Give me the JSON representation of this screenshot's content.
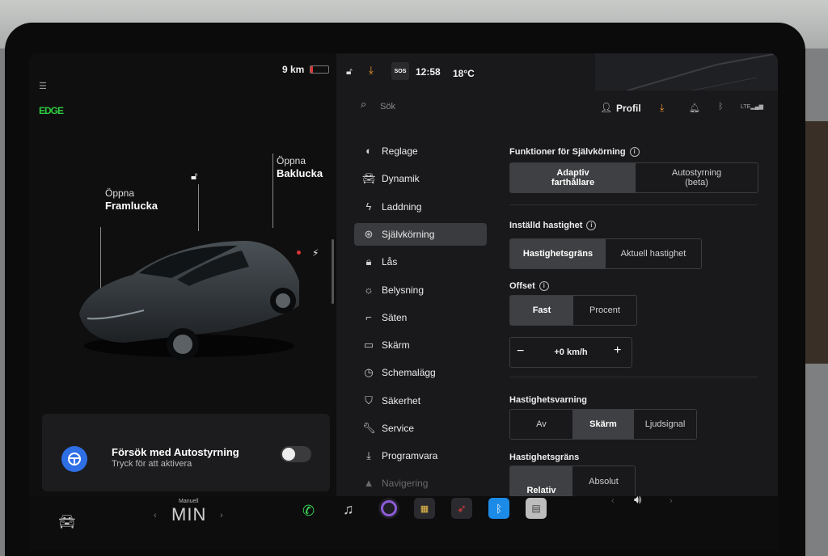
{
  "status": {
    "range": "9 km",
    "time": "12:58",
    "temperature": "18°C",
    "sos": "SOS"
  },
  "car": {
    "frunk_line1": "Öppna",
    "frunk_line2": "Framlucka",
    "trunk_line1": "Öppna",
    "trunk_line2": "Baklucka",
    "edge_badge": "EDGE"
  },
  "autosteer_prompt": {
    "title": "Försök med Autostyrning",
    "subtitle": "Tryck för att aktivera",
    "toggle_on": false
  },
  "header": {
    "search_placeholder": "Sök",
    "profile": "Profil"
  },
  "menu": [
    {
      "label": "Reglage",
      "icon": "toggle-icon"
    },
    {
      "label": "Dynamik",
      "icon": "car-icon"
    },
    {
      "label": "Laddning",
      "icon": "bolt-icon"
    },
    {
      "label": "Självkörning",
      "icon": "steering-wheel-icon",
      "active": true
    },
    {
      "label": "Lås",
      "icon": "lock-icon"
    },
    {
      "label": "Belysning",
      "icon": "sun-icon"
    },
    {
      "label": "Säten",
      "icon": "seat-icon"
    },
    {
      "label": "Skärm",
      "icon": "screen-icon"
    },
    {
      "label": "Schemalägg",
      "icon": "clock-icon"
    },
    {
      "label": "Säkerhet",
      "icon": "shield-icon"
    },
    {
      "label": "Service",
      "icon": "wrench-icon"
    },
    {
      "label": "Programvara",
      "icon": "download-icon"
    },
    {
      "label": "Navigering",
      "icon": "navigation-icon"
    }
  ],
  "settings": {
    "autopilot_features": {
      "title": "Funktioner för Självkörning",
      "opt1_line1": "Adaptiv",
      "opt1_line2": "farthållare",
      "opt2_line1": "Autostyrning",
      "opt2_line2": "(beta)",
      "selected": "Adaptiv farthållare"
    },
    "set_speed": {
      "title": "Inställd hastighet",
      "opt1": "Hastighetsgräns",
      "opt2": "Aktuell hastighet",
      "selected": "Hastighetsgräns"
    },
    "offset": {
      "title": "Offset",
      "opt1": "Fast",
      "opt2": "Procent",
      "selected": "Fast",
      "value": "+0 km/h",
      "minus": "−",
      "plus": "+"
    },
    "speed_warning": {
      "title": "Hastighetsvarning",
      "opt1": "Av",
      "opt2": "Skärm",
      "opt3": "Ljudsignal",
      "selected": "Skärm"
    },
    "speed_limit": {
      "title": "Hastighetsgräns",
      "opt1": "Relativ",
      "opt2": "Absolut",
      "selected": "Relativ"
    }
  },
  "dock": {
    "gear_mode": "Manuell",
    "gear": "MIN"
  },
  "colors": {
    "accent_orange": "#f19a2b",
    "autosteer_blue": "#2f6fe6",
    "edge_green": "#2ecc40",
    "phone_green": "#3ddc5a"
  }
}
